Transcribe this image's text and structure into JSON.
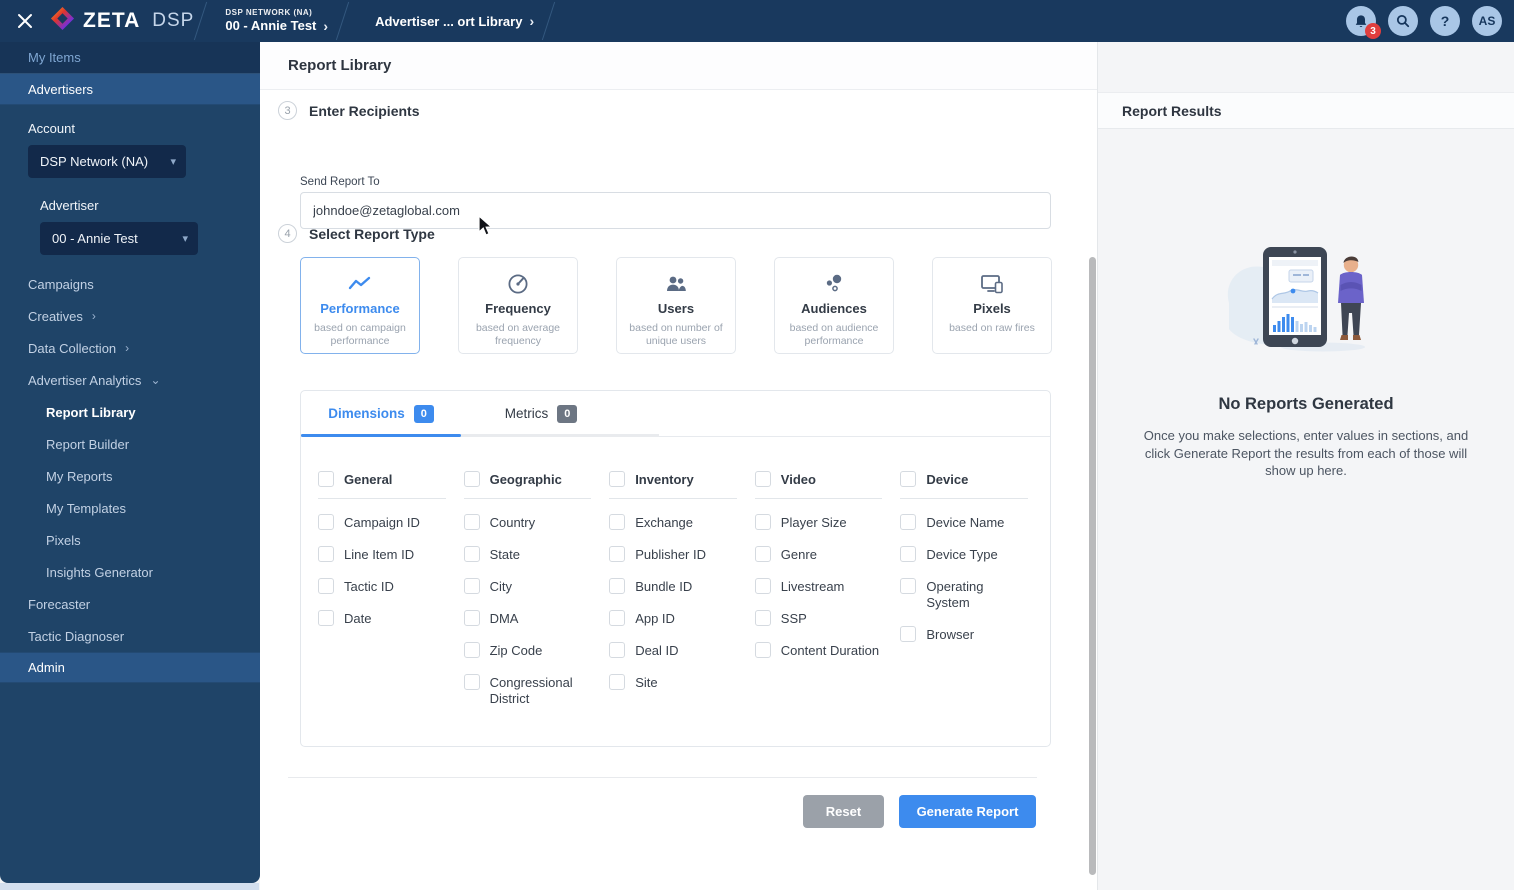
{
  "colors": {
    "accent": "#3d8bee",
    "navbar_navy": "#19395e",
    "sidebar_navy": "#1f4468",
    "band_blue": "#2a5687",
    "badge_red": "#e03e3e",
    "reset_gray": "#9ba1a9"
  },
  "navbar": {
    "brand": "ZETA",
    "brand_suffix": "DSP",
    "crumb_network": "DSP NETWORK (NA)",
    "crumb_advertiser": "00 - Annie Test",
    "crumb_page": "Advertiser ... ort Library",
    "notification_count": "3",
    "help_label": "?",
    "avatar_initials": "AS"
  },
  "sidebar": {
    "my_items": "My Items",
    "advertisers": "Advertisers",
    "account_label": "Account",
    "account_value": "DSP Network (NA)",
    "advertiser_label": "Advertiser",
    "advertiser_value": "00 - Annie Test",
    "nav": [
      {
        "label": "Campaigns"
      },
      {
        "label": "Creatives"
      },
      {
        "label": "Data Collection"
      },
      {
        "label": "Advertiser Analytics"
      }
    ],
    "analytics_children": [
      {
        "label": "Report Library"
      },
      {
        "label": "Report Builder"
      },
      {
        "label": "My Reports"
      },
      {
        "label": "My Templates"
      },
      {
        "label": "Pixels"
      },
      {
        "label": "Insights Generator"
      }
    ],
    "nav_bottom": [
      {
        "label": "Forecaster"
      },
      {
        "label": "Tactic Diagnoser"
      }
    ],
    "admin": "Admin"
  },
  "main": {
    "page_title": "Report Library",
    "recipients": {
      "step": "3",
      "title": "Enter Recipients",
      "label": "Send Report To",
      "value": "johndoe@zetaglobal.com"
    },
    "report_type": {
      "step": "4",
      "title": "Select Report Type",
      "cards": [
        {
          "title": "Performance",
          "subtitle": "based on campaign performance"
        },
        {
          "title": "Frequency",
          "subtitle": "based on average frequency"
        },
        {
          "title": "Users",
          "subtitle": "based on number of unique users"
        },
        {
          "title": "Audiences",
          "subtitle": "based on audience performance"
        },
        {
          "title": "Pixels",
          "subtitle": "based on raw fires"
        }
      ]
    },
    "tabs": {
      "dimensions": "Dimensions",
      "dimensions_count": "0",
      "metrics": "Metrics",
      "metrics_count": "0"
    },
    "groups": [
      {
        "header": "General",
        "items": [
          "Campaign ID",
          "Line Item ID",
          "Tactic ID",
          "Date"
        ]
      },
      {
        "header": "Geographic",
        "items": [
          "Country",
          "State",
          "City",
          "DMA",
          "Zip Code",
          "Congressional District"
        ]
      },
      {
        "header": "Inventory",
        "items": [
          "Exchange",
          "Publisher ID",
          "Bundle ID",
          "App ID",
          "Deal ID",
          "Site"
        ]
      },
      {
        "header": "Video",
        "items": [
          "Player Size",
          "Genre",
          "Livestream",
          "SSP",
          "Content Duration"
        ]
      },
      {
        "header": "Device",
        "items": [
          "Device Name",
          "Device Type",
          "Operating System",
          "Browser"
        ]
      }
    ],
    "actions": {
      "reset": "Reset",
      "generate": "Generate Report"
    }
  },
  "results": {
    "title": "Report Results",
    "empty_title": "No Reports Generated",
    "empty_message": "Once you make selections, enter values in sections, and click Generate Report the results from each of those will show up here."
  }
}
